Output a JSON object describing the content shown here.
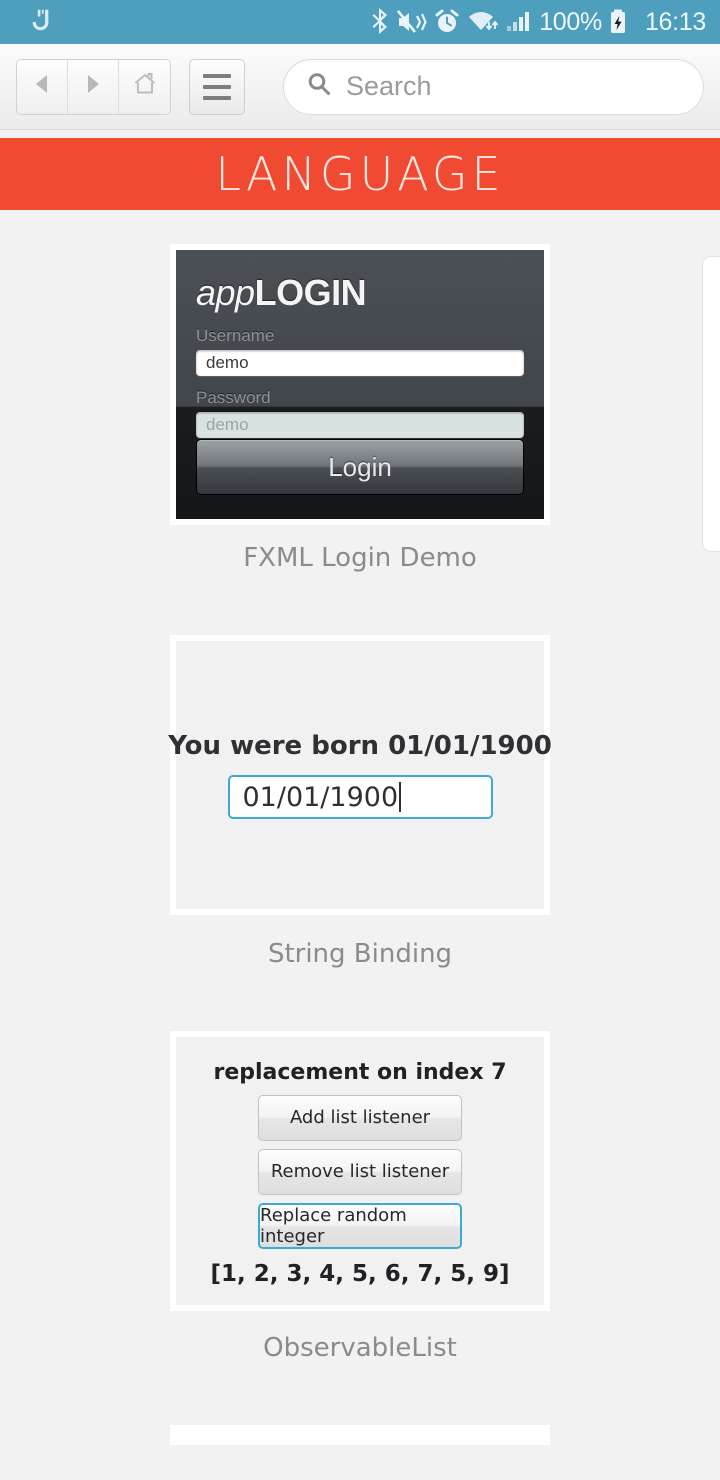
{
  "statusbar": {
    "logo_icon": "app-logo-icon",
    "icons": [
      "bluetooth-icon",
      "mute-vibrate-icon",
      "alarm-clock-icon",
      "wifi-icon",
      "cellular-signal-icon"
    ],
    "battery_percent": "100%",
    "battery_icon": "battery-charging-icon",
    "time": "16:13",
    "bg_color": "#4e9ebd",
    "text_color": "#f0f7fa"
  },
  "toolbar": {
    "back_icon": "back-arrow-icon",
    "forward_icon": "forward-arrow-icon",
    "home_icon": "home-icon",
    "menu_icon": "hamburger-menu-icon",
    "search_icon": "search-icon",
    "search_value": "",
    "search_placeholder": "Search"
  },
  "banner": {
    "title": "LANGUAGE",
    "bg_color": "#f04a32",
    "text_color": "#fce7e1"
  },
  "samples": [
    {
      "caption": "FXML Login Demo",
      "login": {
        "logo_italic": "app",
        "logo_bold": "LOGIN",
        "username_label": "Username",
        "username_value": "demo",
        "password_label": "Password",
        "password_value": "demo",
        "login_button": "Login"
      }
    },
    {
      "caption": "String Binding",
      "binding": {
        "label": "You were born 01/01/1900",
        "input_value": "01/01/1900",
        "focus_color": "#3fa9d0"
      }
    },
    {
      "caption": "ObservableList",
      "observable": {
        "status": "replacement on index 7",
        "buttons": [
          {
            "label": "Add list listener",
            "focused": false
          },
          {
            "label": "Remove list listener",
            "focused": false
          },
          {
            "label": "Replace random integer",
            "focused": true
          }
        ],
        "list_value": "[1, 2, 3, 4, 5, 6, 7, 5, 9]",
        "focus_color": "#3fa9d0"
      }
    }
  ],
  "page": {
    "background_color": "#f2f2f2",
    "card_color": "#ffffff"
  }
}
